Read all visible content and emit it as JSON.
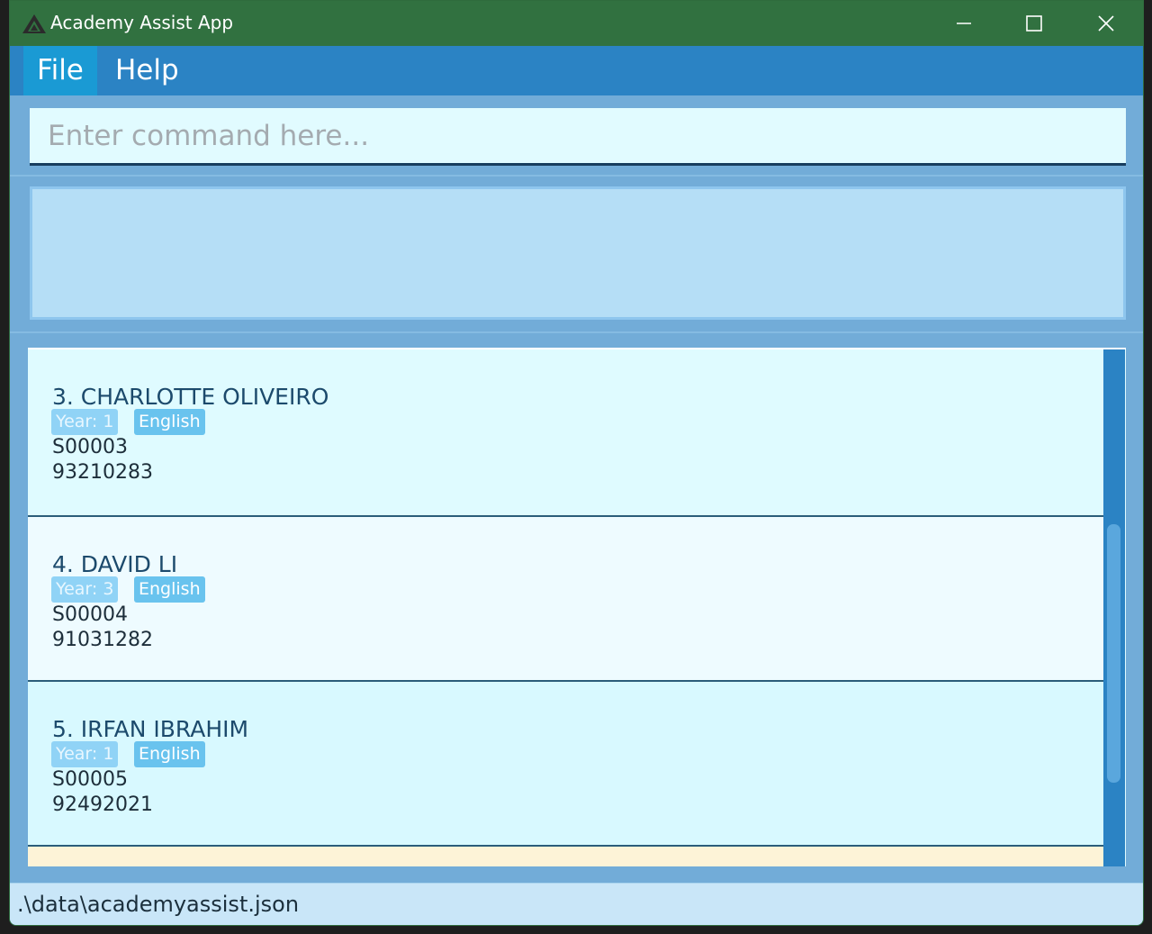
{
  "window": {
    "title": "Academy Assist App"
  },
  "menu": {
    "file_label": "File",
    "help_label": "Help"
  },
  "command": {
    "placeholder": "Enter command here...",
    "value": ""
  },
  "result": {
    "text": ""
  },
  "students": [
    {
      "index_name": "3. CHARLOTTE OLIVEIRO",
      "year_tag": "Year: 1",
      "subject_tag": "English",
      "id": "S00003",
      "phone": "93210283"
    },
    {
      "index_name": "4. DAVID LI",
      "year_tag": "Year: 3",
      "subject_tag": "English",
      "id": "S00004",
      "phone": "91031282"
    },
    {
      "index_name": "5. IRFAN IBRAHIM",
      "year_tag": "Year: 1",
      "subject_tag": "English",
      "id": "S00005",
      "phone": "92492021"
    }
  ],
  "status": {
    "file_path": ".\\data\\academyassist.json"
  },
  "colors": {
    "titlebar": "#317140",
    "menubar": "#2b83c4",
    "accent": "#1a9ad4"
  }
}
